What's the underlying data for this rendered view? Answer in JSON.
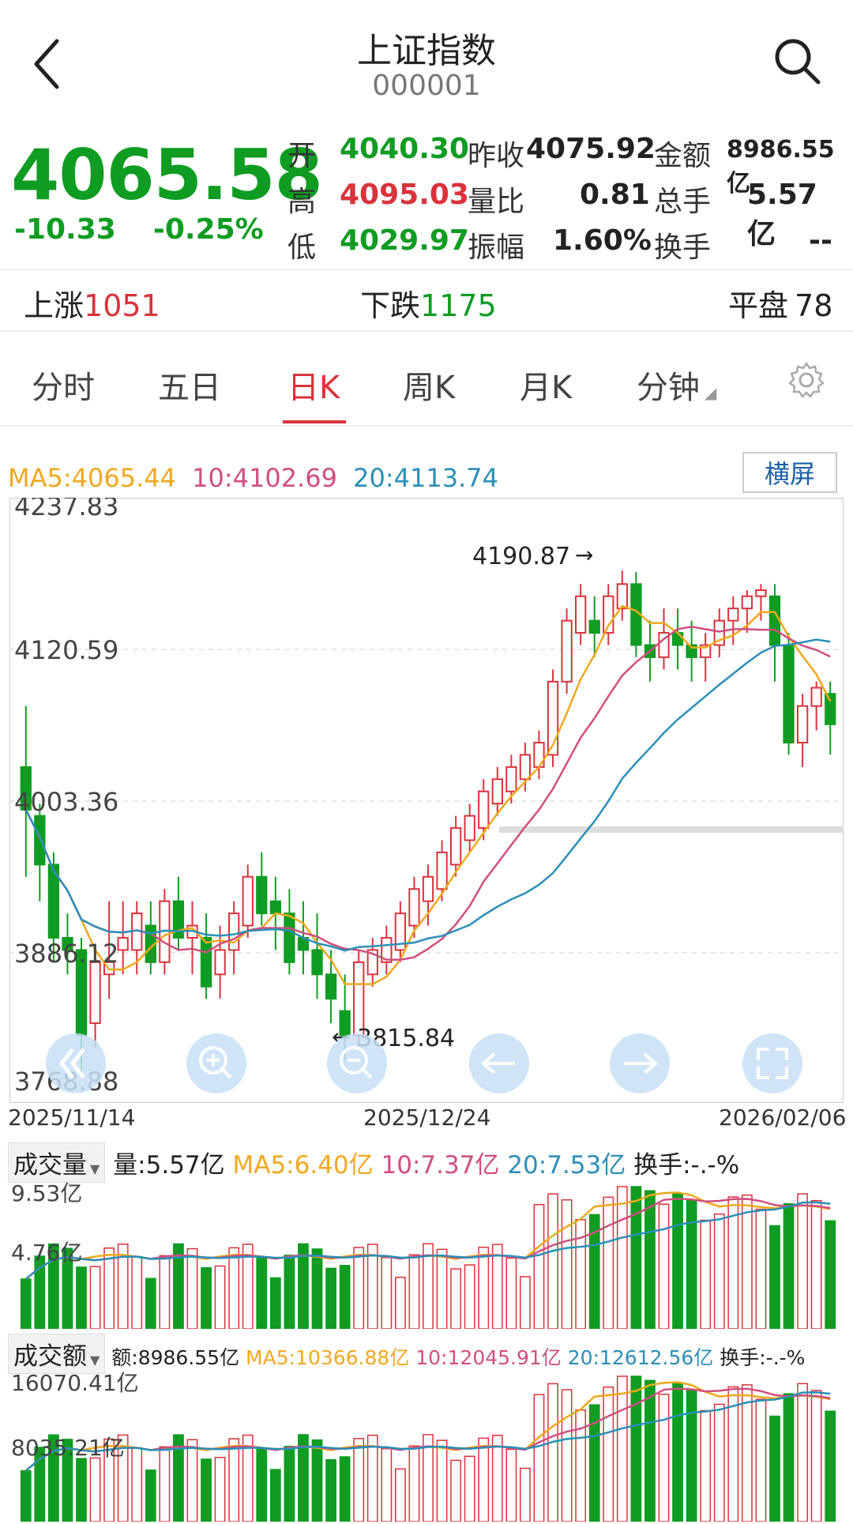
{
  "header": {
    "title": "上证指数",
    "code": "000001"
  },
  "quote": {
    "price": "4065.58",
    "change": "-10.33",
    "change_pct": "-0.25%",
    "stats": [
      {
        "label": "开",
        "value": "4040.30",
        "tone": "green"
      },
      {
        "label": "昨收",
        "value": "4075.92",
        "tone": "black"
      },
      {
        "label": "金额",
        "value": "8986.55亿",
        "tone": "black"
      },
      {
        "label": "高",
        "value": "4095.03",
        "tone": "red"
      },
      {
        "label": "量比",
        "value": "0.81",
        "tone": "black"
      },
      {
        "label": "总手",
        "value": "5.57亿",
        "tone": "black"
      },
      {
        "label": "低",
        "value": "4029.97",
        "tone": "green"
      },
      {
        "label": "振幅",
        "value": "1.60%",
        "tone": "black"
      },
      {
        "label": "换手",
        "value": "--",
        "tone": "black"
      }
    ]
  },
  "breadth": {
    "up_label": "上涨",
    "up_value": "1051",
    "down_label": "下跌",
    "down_value": "1175",
    "flat_label": "平盘",
    "flat_value": "78"
  },
  "tabs": [
    "分时",
    "五日",
    "日K",
    "周K",
    "月K",
    "分钟"
  ],
  "active_tab": "日K",
  "ma_legend": {
    "ma5": "MA5:4065.44",
    "ma10": "10:4102.69",
    "ma20": "20:4113.74"
  },
  "landscape_label": "横屏",
  "price_axis": [
    "4237.83",
    "4120.59",
    "4003.36",
    "3886.12",
    "3768.88"
  ],
  "annotations": {
    "high": "4190.87",
    "low": "3815.84"
  },
  "date_axis": [
    "2025/11/14",
    "2025/12/24",
    "2026/02/06"
  ],
  "volume_panel": {
    "title": "成交量",
    "current": "量:5.57亿",
    "ma5": "MA5:6.40亿",
    "ma10": "10:7.37亿",
    "ma20": "20:7.53亿",
    "turnover": "换手:-.-%",
    "max_label": "9.53亿",
    "mid_label": "4.76亿"
  },
  "amount_panel": {
    "title": "成交额",
    "current": "额:8986.55亿",
    "ma5": "MA5:10366.88亿",
    "ma10": "10:12045.91亿",
    "ma20": "20:12612.56亿",
    "turnover": "换手:-.-%",
    "max_label": "16070.41亿",
    "mid_label": "8035.21亿"
  },
  "colors": {
    "up": "#d9333b",
    "down": "#0f9c22",
    "ma5": "#f0a81e",
    "ma10": "#cf4f7f",
    "ma20": "#2b8fb8",
    "accent": "#1a5fa8"
  },
  "controls": [
    "rewind-icon",
    "zoom-in-icon",
    "zoom-out-icon",
    "left-arrow-icon",
    "right-arrow-icon",
    "fullscreen-icon"
  ],
  "chart_data": {
    "type": "candlestick",
    "ylim": [
      3768.88,
      4237.83
    ],
    "x_start": "2025/11/14",
    "x_end": "2026/02/06",
    "candles": [
      [
        4030,
        4080,
        3940,
        3995
      ],
      [
        3990,
        4000,
        3920,
        3950
      ],
      [
        3950,
        3960,
        3870,
        3890
      ],
      [
        3890,
        3910,
        3860,
        3880
      ],
      [
        3880,
        3890,
        3780,
        3810
      ],
      [
        3820,
        3880,
        3800,
        3870
      ],
      [
        3860,
        3920,
        3840,
        3870
      ],
      [
        3880,
        3920,
        3860,
        3890
      ],
      [
        3880,
        3920,
        3860,
        3910
      ],
      [
        3900,
        3920,
        3860,
        3870
      ],
      [
        3870,
        3930,
        3860,
        3920
      ],
      [
        3920,
        3940,
        3880,
        3890
      ],
      [
        3890,
        3920,
        3860,
        3900
      ],
      [
        3890,
        3910,
        3840,
        3850
      ],
      [
        3860,
        3900,
        3840,
        3880
      ],
      [
        3880,
        3920,
        3860,
        3910
      ],
      [
        3900,
        3950,
        3890,
        3940
      ],
      [
        3940,
        3960,
        3900,
        3910
      ],
      [
        3920,
        3940,
        3880,
        3910
      ],
      [
        3910,
        3930,
        3860,
        3870
      ],
      [
        3890,
        3920,
        3860,
        3880
      ],
      [
        3880,
        3910,
        3840,
        3860
      ],
      [
        3860,
        3880,
        3820,
        3840
      ],
      [
        3830,
        3860,
        3790,
        3810
      ],
      [
        3810,
        3880,
        3800,
        3870
      ],
      [
        3860,
        3890,
        3850,
        3880
      ],
      [
        3870,
        3900,
        3860,
        3890
      ],
      [
        3880,
        3920,
        3870,
        3910
      ],
      [
        3900,
        3940,
        3890,
        3930
      ],
      [
        3920,
        3950,
        3900,
        3940
      ],
      [
        3930,
        3970,
        3920,
        3960
      ],
      [
        3950,
        3990,
        3940,
        3980
      ],
      [
        3970,
        4000,
        3960,
        3990
      ],
      [
        3980,
        4020,
        3970,
        4010
      ],
      [
        4000,
        4030,
        3990,
        4020
      ],
      [
        4010,
        4040,
        4000,
        4030
      ],
      [
        4020,
        4050,
        4010,
        4040
      ],
      [
        4030,
        4060,
        4020,
        4050
      ],
      [
        4040,
        4110,
        4030,
        4100
      ],
      [
        4100,
        4160,
        4090,
        4150
      ],
      [
        4140,
        4180,
        4130,
        4170
      ],
      [
        4150,
        4170,
        4120,
        4140
      ],
      [
        4140,
        4180,
        4130,
        4170
      ],
      [
        4160,
        4191,
        4150,
        4180
      ],
      [
        4180,
        4190,
        4120,
        4130
      ],
      [
        4130,
        4150,
        4100,
        4120
      ],
      [
        4120,
        4160,
        4110,
        4140
      ],
      [
        4140,
        4160,
        4110,
        4130
      ],
      [
        4130,
        4150,
        4100,
        4120
      ],
      [
        4120,
        4140,
        4100,
        4130
      ],
      [
        4130,
        4160,
        4120,
        4150
      ],
      [
        4150,
        4170,
        4130,
        4160
      ],
      [
        4160,
        4175,
        4140,
        4170
      ],
      [
        4170,
        4180,
        4150,
        4175
      ],
      [
        4170,
        4180,
        4100,
        4130
      ],
      [
        4130,
        4140,
        4040,
        4050
      ],
      [
        4050,
        4090,
        4030,
        4080
      ],
      [
        4080,
        4100,
        4060,
        4095
      ],
      [
        4090,
        4100,
        4040,
        4065
      ]
    ],
    "volume_max": 9.53,
    "amount_max": 16070.41
  }
}
